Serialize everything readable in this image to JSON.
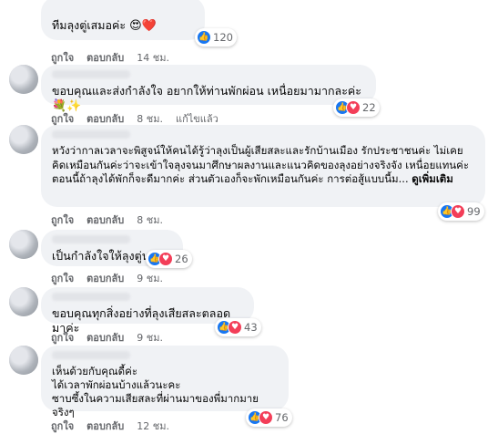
{
  "labels": {
    "like": "ถูกใจ",
    "reply": "ตอบกลับ",
    "edited": "แก้ไขแล้ว",
    "see_more": "ดูเพิ่มเติม"
  },
  "colors": {
    "like": "#1877f2",
    "love": "#f33e58",
    "bubble": "#f0f2f5",
    "meta": "#65676b"
  },
  "comments": [
    {
      "text": "ทีมลุงตู่เสมอค่ะ",
      "emoji": "😍❤️",
      "time": "14 ชม.",
      "reactions": "120",
      "react_icons": [
        "like-icon"
      ]
    },
    {
      "text": "ขอบคุณและส่งกำลังใจ อยากให้ท่านพักผ่อน เหนื่อยมามากละค่ะ",
      "emoji": "💐✨",
      "time": "8 ชม.",
      "edited": true,
      "reactions": "22",
      "react_icons": [
        "like-icon",
        "love-icon"
      ]
    },
    {
      "text": "หวังว่ากาลเวลาจะพิสูจน์ให้คนได้รู้ว่าลุงเป็นผู้เสียสละและรักบ้านเมือง รักประชาชนค่ะ ไม่เคยคิดเหมือนกันค่ะว่าจะเข้าใจลุงจนมาศึกษาผลงานและแนวคิดของลุงอย่างจริงจัง เหนื่อยแทนค่ะ ตอนนี้ถ้าลุงได้พักก็จะดีมากค่ะ ส่วนตัวเองก็จะพักเหมือนกันค่ะ การต่อสู้แบบนี้ม...",
      "time": "8 ชม.",
      "reactions": "99",
      "react_icons": [
        "like-icon",
        "love-icon"
      ]
    },
    {
      "text": "เป็นกำลังใจให้ลุงตู่นะคะ",
      "time": "9 ชม.",
      "reactions": "26",
      "react_icons": [
        "like-icon",
        "love-icon"
      ]
    },
    {
      "text": "ขอบคุณทุกสิ่งอย่างที่ลุงเสียสละตลอดมาค่ะ",
      "time": "9 ชม.",
      "reactions": "43",
      "react_icons": [
        "like-icon",
        "love-icon"
      ]
    },
    {
      "text": "เห็นด้วยกับคุณดี้ค่ะ\nได้เวลาพักผ่อนบ้างแล้วนะคะ\nซาบซึ้งในความเสียสละที่ผ่านมาของพี่มากมายจริงๆ",
      "time": "12 ชม.",
      "reactions": "76",
      "react_icons": [
        "like-icon",
        "love-icon"
      ]
    }
  ]
}
